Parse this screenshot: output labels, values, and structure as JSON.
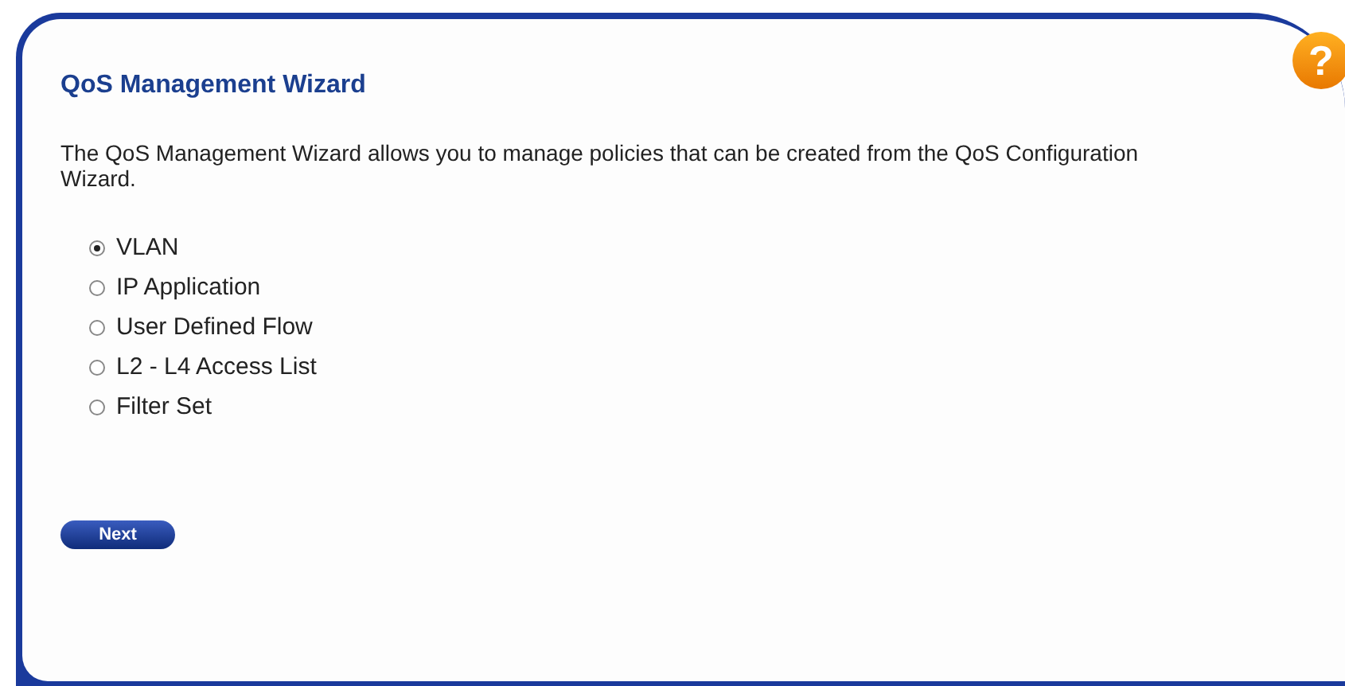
{
  "title": "QoS Management Wizard",
  "description": "The QoS Management Wizard allows you to manage policies that can be created from the QoS Configuration Wizard.",
  "options": [
    {
      "label": "VLAN",
      "selected": true
    },
    {
      "label": "IP Application",
      "selected": false
    },
    {
      "label": "User Defined Flow",
      "selected": false
    },
    {
      "label": "L2 - L4 Access List",
      "selected": false
    },
    {
      "label": "Filter Set",
      "selected": false
    }
  ],
  "next_button": "Next",
  "help_icon": "?"
}
